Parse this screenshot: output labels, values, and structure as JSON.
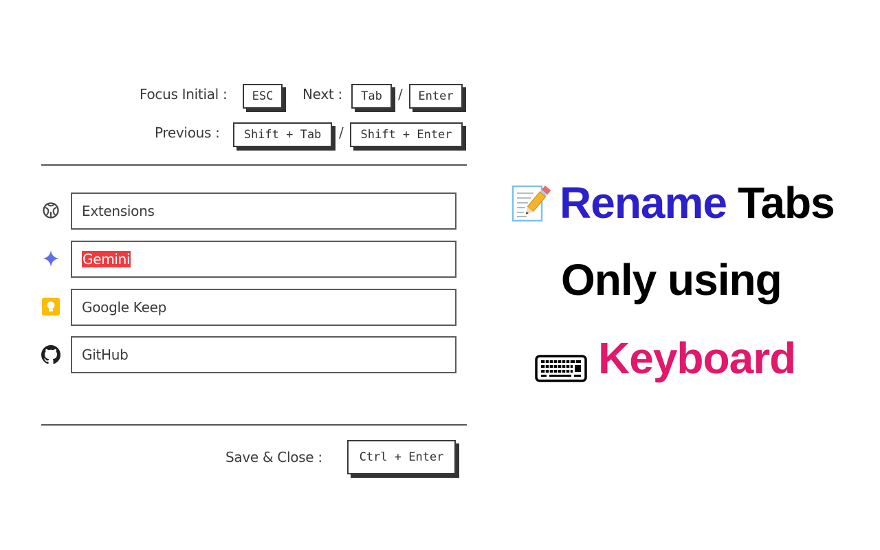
{
  "shortcuts": {
    "focus_initial_label": "Focus Initial :",
    "focus_initial_key": "ESC",
    "next_label": "Next :",
    "next_key_1": "Tab",
    "next_separator": "/",
    "next_key_2": "Enter",
    "previous_label": "Previous :",
    "previous_key_1": "Shift + Tab",
    "previous_separator": "/",
    "previous_key_2": "Shift + Enter"
  },
  "tabs": [
    {
      "icon": "extensions-icon",
      "value": "Extensions"
    },
    {
      "icon": "gemini-icon",
      "value": "Gemini",
      "selected": true
    },
    {
      "icon": "google-keep-icon",
      "value": "Google Keep"
    },
    {
      "icon": "github-icon",
      "value": "GitHub"
    }
  ],
  "footer": {
    "save_label": "Save & Close :",
    "save_key": "Ctrl + Enter"
  },
  "promo": {
    "line1_icon": "memo-pencil-emoji",
    "line1_highlight": "Rename",
    "line1_rest": "Tabs",
    "line2": "Only using",
    "line3_icon": "keyboard-emoji",
    "line3_highlight": "Keyboard",
    "colors": {
      "rename": "#2b20c9",
      "keyboard": "#e0196b",
      "selection": "#f03a3f"
    }
  }
}
